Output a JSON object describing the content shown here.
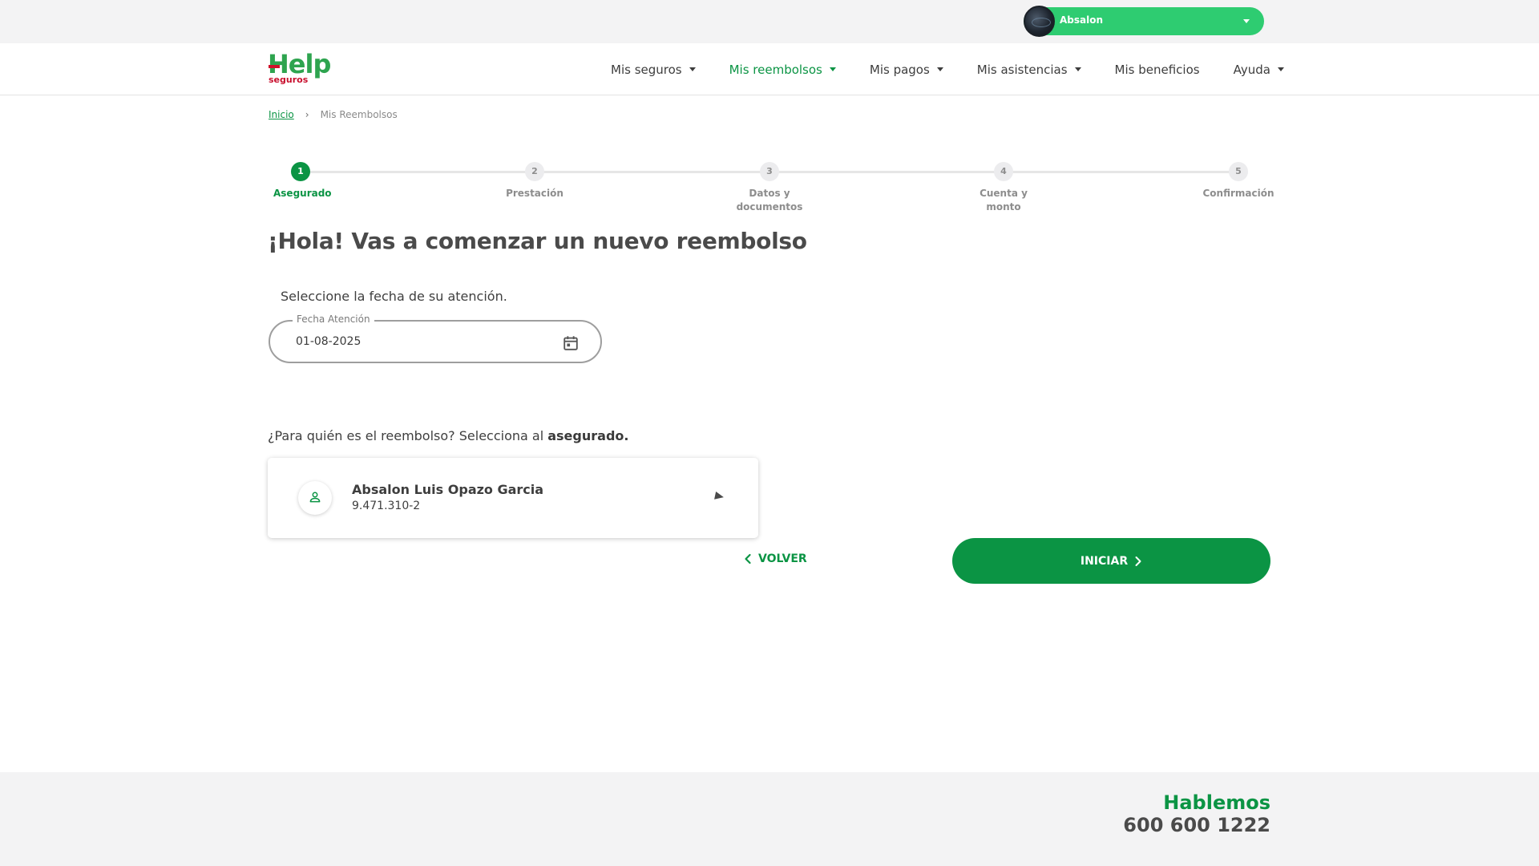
{
  "user": {
    "name": "Absalon",
    "avatar": "avatar-image",
    "accent_color": "#2ecc71"
  },
  "brand": {
    "logo_main": "Help",
    "logo_sub": "seguros",
    "primary_color": "#0b9444",
    "secondary_color": "#c8102e"
  },
  "nav": {
    "items": [
      {
        "label": "Mis seguros",
        "dropdown": true,
        "active": false
      },
      {
        "label": "Mis reembolsos",
        "dropdown": true,
        "active": true
      },
      {
        "label": "Mis pagos",
        "dropdown": true,
        "active": false
      },
      {
        "label": "Mis asistencias",
        "dropdown": true,
        "active": false
      },
      {
        "label": "Mis beneficios",
        "dropdown": false,
        "active": false
      },
      {
        "label": "Ayuda",
        "dropdown": true,
        "active": false
      }
    ]
  },
  "breadcrumb": {
    "home": "Inicio",
    "separator": "›",
    "current": "Mis Reembolsos"
  },
  "stepper": {
    "current_step": 1,
    "steps": [
      {
        "number": "1",
        "label": "Asegurado"
      },
      {
        "number": "2",
        "label": "Prestación"
      },
      {
        "number": "3",
        "label_line1": "Datos y",
        "label_line2": "documentos"
      },
      {
        "number": "4",
        "label_line1": "Cuenta y",
        "label_line2": "monto"
      },
      {
        "number": "5",
        "label": "Confirmación"
      }
    ]
  },
  "main": {
    "title": "¡Hola! Vas a comenzar un nuevo reembolso",
    "date_prompt": "Seleccione la fecha de su atención.",
    "date_field": {
      "label": "Fecha Atención",
      "value": "01-08-2025",
      "icon": "calendar-icon"
    },
    "who_prompt_prefix": "¿Para quién es el reembolso? Selecciona al ",
    "who_prompt_bold": "asegurado.",
    "insured": {
      "icon": "person-icon",
      "name": "Absalon Luis Opazo Garcia",
      "rut": "9.471.310-2"
    }
  },
  "actions": {
    "back_label": "VOLVER",
    "start_label": "INICIAR"
  },
  "footer": {
    "label": "Hablemos",
    "phone": "600 600 1222"
  }
}
